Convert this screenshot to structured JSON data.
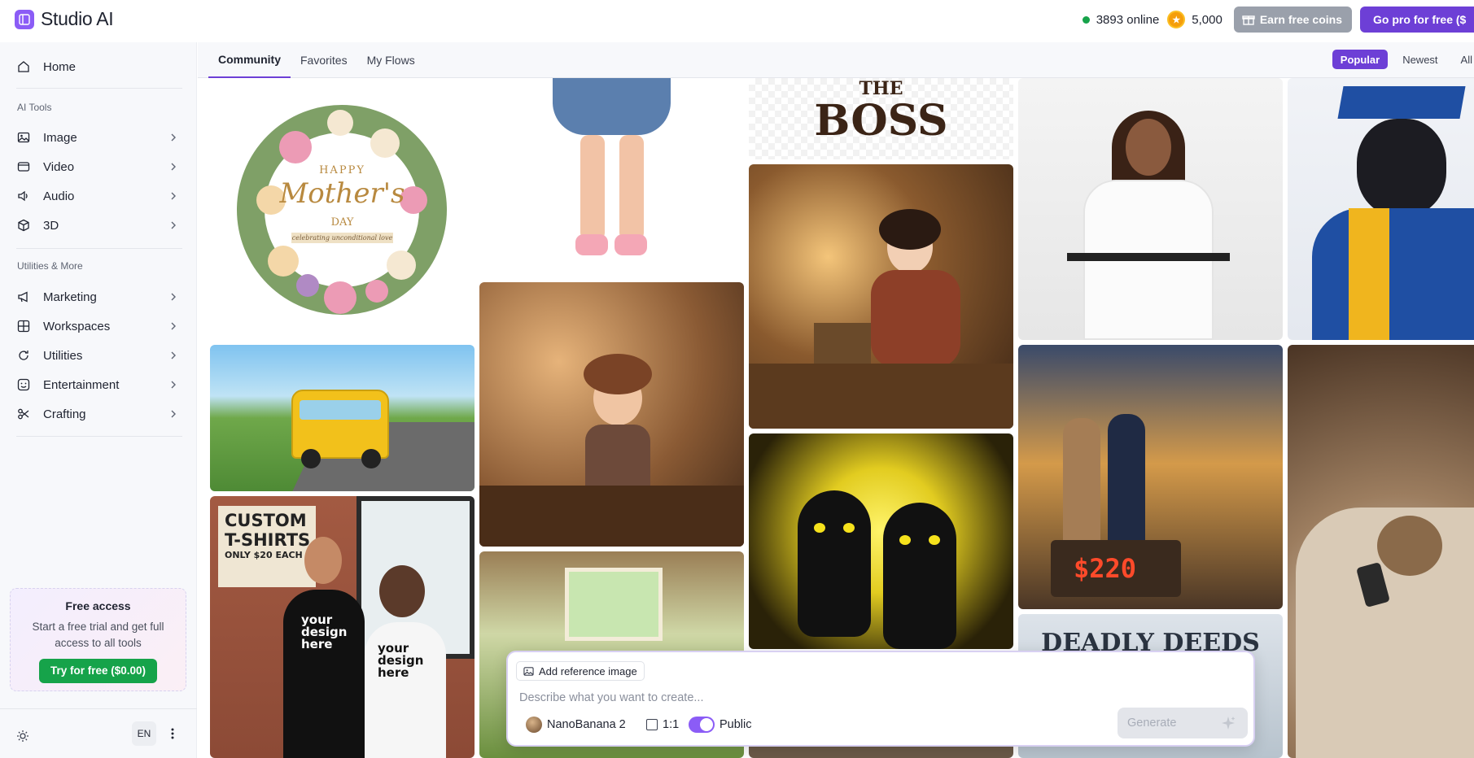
{
  "app": {
    "title": "Studio AI"
  },
  "header": {
    "online_count": "3893 online",
    "coins": "5,000",
    "earn_label": "Earn free coins",
    "pro_label": "Go pro for free ($"
  },
  "sidebar": {
    "home": "Home",
    "section_ai": "AI Tools",
    "ai_items": [
      {
        "label": "Image",
        "icon": "image-icon"
      },
      {
        "label": "Video",
        "icon": "video-icon"
      },
      {
        "label": "Audio",
        "icon": "audio-icon"
      },
      {
        "label": "3D",
        "icon": "cube-icon"
      }
    ],
    "section_util": "Utilities & More",
    "util_items": [
      {
        "label": "Marketing",
        "icon": "megaphone-icon"
      },
      {
        "label": "Workspaces",
        "icon": "grid-icon"
      },
      {
        "label": "Utilities",
        "icon": "refresh-icon"
      },
      {
        "label": "Entertainment",
        "icon": "smile-icon"
      },
      {
        "label": "Crafting",
        "icon": "scissors-icon"
      }
    ],
    "free_card": {
      "title": "Free access",
      "desc": "Start a free trial and get full access to all tools",
      "button": "Try for free ($0.00)"
    },
    "language": "EN"
  },
  "tabs": [
    "Community",
    "Favorites",
    "My Flows"
  ],
  "sort": [
    "Popular",
    "Newest",
    "All"
  ],
  "gallery": {
    "mothers_day": {
      "line1": "HAPPY",
      "line2": "Mother's",
      "line3": "DAY",
      "ribbon": "celebrating unconditional love"
    },
    "boss": {
      "line1": "THE",
      "line2": "BOSS"
    },
    "tshirt": {
      "sign1": "CUSTOM",
      "sign2": "T-SHIRTS",
      "sign3": "ONLY $20 EACH",
      "shirt1": "your design here",
      "shirt2": "your design here"
    },
    "price": "$220",
    "deadly": "DEADLY DEEDS"
  },
  "prompt": {
    "ref_label": "Add reference image",
    "placeholder": "Describe what you want to create...",
    "model": "NanoBanana 2",
    "ratio": "1:1",
    "public": "Public",
    "generate": "Generate"
  },
  "colors": {
    "accent": "#6d3fd6",
    "online": "#16a34a",
    "try_button": "#16a34a",
    "earn_button": "#9aa0ab"
  }
}
